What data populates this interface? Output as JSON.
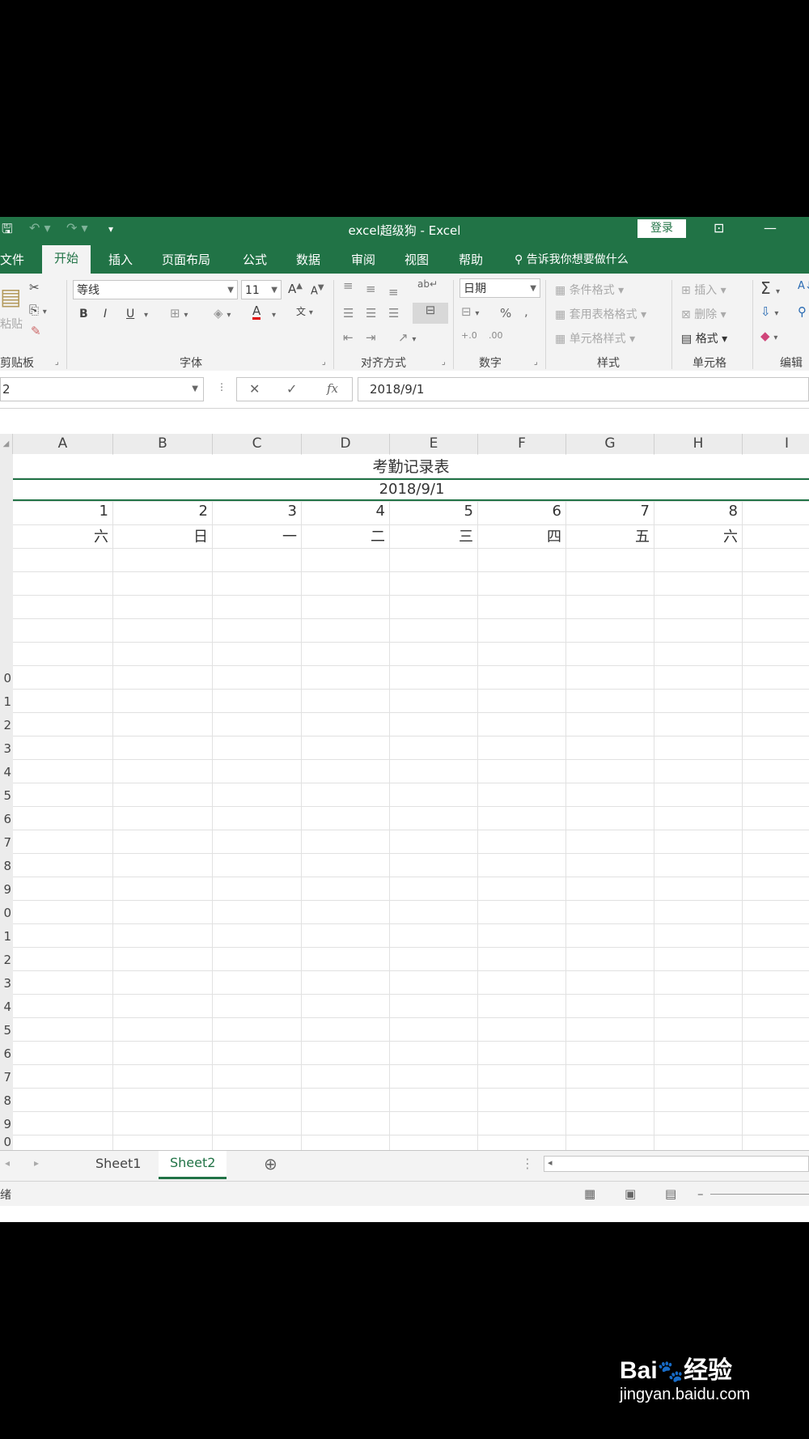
{
  "titlebar": {
    "title": "excel超级狗 - Excel",
    "login": "登录"
  },
  "tabs": [
    "文件",
    "开始",
    "插入",
    "页面布局",
    "公式",
    "数据",
    "审阅",
    "视图",
    "帮助"
  ],
  "active_tab": "开始",
  "tell_me": "告诉我你想要做什么",
  "ribbon": {
    "clipboard": {
      "name": "剪贴板",
      "paste": "粘贴"
    },
    "font": {
      "name": "字体",
      "font_family": "等线",
      "font_size": "11",
      "bold": "B",
      "italic": "I",
      "underline": "U"
    },
    "alignment": {
      "name": "对齐方式"
    },
    "number": {
      "name": "数字",
      "format": "日期",
      "percent": "%"
    },
    "styles": {
      "name": "样式",
      "conditional": "条件格式",
      "table": "套用表格格式",
      "cell_styles": "单元格样式"
    },
    "cells": {
      "name": "单元格",
      "insert": "插入",
      "delete": "删除",
      "format": "格式"
    },
    "editing": {
      "name": "编辑"
    }
  },
  "formula_bar": {
    "name_box": "2",
    "value": "2018/9/1",
    "fx": "fx"
  },
  "columns": [
    "A",
    "B",
    "C",
    "D",
    "E",
    "F",
    "G",
    "H",
    "I"
  ],
  "row_numbers": [
    "0",
    "1",
    "2",
    "3",
    "4",
    "5",
    "6",
    "7",
    "8",
    "9",
    "0",
    "1",
    "2",
    "3",
    "4",
    "5",
    "6",
    "7",
    "8",
    "9",
    "0"
  ],
  "sheet": {
    "title": "考勤记录表",
    "date": "2018/9/1",
    "day_numbers": [
      "1",
      "2",
      "3",
      "4",
      "5",
      "6",
      "7",
      "8"
    ],
    "weekdays": [
      "六",
      "日",
      "一",
      "二",
      "三",
      "四",
      "五",
      "六"
    ]
  },
  "sheet_tabs": [
    "Sheet1",
    "Sheet2"
  ],
  "active_sheet": "Sheet2",
  "status": {
    "left": "绪"
  },
  "accent_color": "#217346"
}
